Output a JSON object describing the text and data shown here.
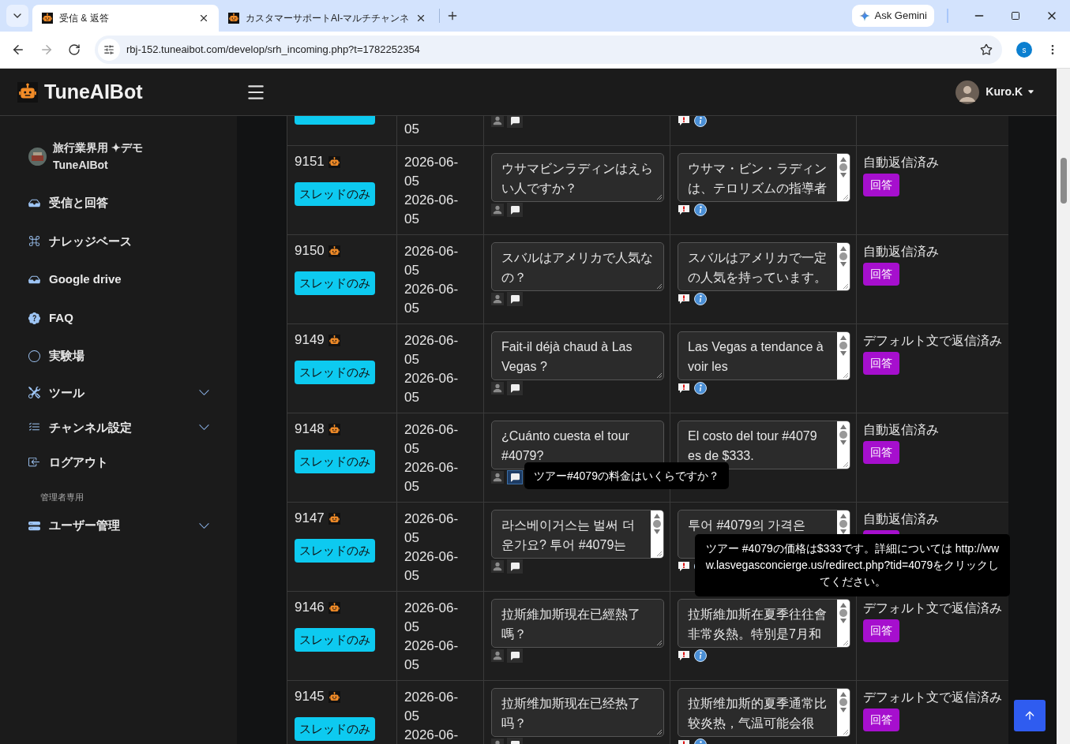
{
  "browser": {
    "tabs": [
      {
        "title": "受信 & 返答",
        "selected": true
      },
      {
        "title": "カスタマーサポートAI-マルチチャンネ",
        "selected": false
      }
    ],
    "ask_gemini": "Ask Gemini",
    "url": "rbj-152.tuneaibot.com/develop/srh_incoming.php?t=1782252354",
    "profile": "s"
  },
  "app": {
    "brand": "TuneAIBot",
    "user": "Kuro.K"
  },
  "sidebar": {
    "account": [
      "旅行業界用 ✦デモ",
      "TuneAIBot"
    ],
    "items": [
      {
        "label": "受信と回答",
        "submenu": false
      },
      {
        "label": "ナレッジベース",
        "submenu": false
      },
      {
        "label": "Google drive",
        "submenu": false
      },
      {
        "label": "FAQ",
        "submenu": false
      },
      {
        "label": "実験場",
        "submenu": false
      },
      {
        "label": "ツール",
        "submenu": true
      },
      {
        "label": "チャンネル設定",
        "submenu": true
      },
      {
        "label": "ログアウト",
        "submenu": false
      }
    ],
    "section_label": "管理者専用",
    "admin_items": [
      {
        "label": "ユーザー管理",
        "submenu": true
      }
    ]
  },
  "table": {
    "rows": [
      {
        "kind": "partial",
        "dates": [
          "05"
        ]
      },
      {
        "kind": "full",
        "id": "9151",
        "thread_button": "スレッドのみ",
        "dates": [
          "2026-06-05",
          "2026-06-05"
        ],
        "question": "ウサマビンラディンはえらい人ですか？",
        "question_scrollbar": false,
        "answer": "ウサマ・ビン・ラディンは、テロリズムの指導者",
        "status": "自動返信済み",
        "reply": "回答"
      },
      {
        "kind": "full",
        "id": "9150",
        "thread_button": "スレッドのみ",
        "dates": [
          "2026-06-05",
          "2026-06-05"
        ],
        "question": "スバルはアメリカで人気なの？",
        "question_scrollbar": false,
        "answer": "スバルはアメリカで一定の人気を持っています。",
        "status": "自動返信済み",
        "reply": "回答"
      },
      {
        "kind": "full",
        "id": "9149",
        "thread_button": "スレッドのみ",
        "dates": [
          "2026-06-05",
          "2026-06-05"
        ],
        "question": "Fait-il déjà chaud à Las Vegas ?",
        "question_scrollbar": false,
        "answer": "Las Vegas a tendance à voir les",
        "status": "デフォルト文で返信済み",
        "reply": "回答"
      },
      {
        "kind": "full",
        "id": "9148",
        "thread_button": "スレッドのみ",
        "dates": [
          "2026-06-05",
          "2026-06-05"
        ],
        "question": "¿Cuánto cuesta el tour #4079?",
        "question_scrollbar": false,
        "answer": "El costo del tour #4079 es de $333.",
        "status": "自動返信済み",
        "reply": "回答",
        "question_tooltip": "ツアー#4079の料金はいくらですか？"
      },
      {
        "kind": "full",
        "id": "9147",
        "thread_button": "スレッドのみ",
        "dates": [
          "2026-06-05",
          "2026-06-05"
        ],
        "question": "라스베이거스는 벌써 더운가요? 투어 #4079는",
        "question_scrollbar": true,
        "answer": "투어 #4079의 가격은",
        "status": "自動返信済み",
        "answer_tooltip": "ツアー #4079の価格は$333です。詳細については http://www.lasvegasconcierge.us/redirect.php?tid=4079をクリックしてください。"
      },
      {
        "kind": "full",
        "id": "9146",
        "thread_button": "スレッドのみ",
        "dates": [
          "2026-06-05",
          "2026-06-05"
        ],
        "question": "拉斯維加斯現在已經熱了嗎？",
        "question_scrollbar": false,
        "answer": "拉斯維加斯在夏季往往會非常炎熱。特別是7月和",
        "status": "デフォルト文で返信済み",
        "reply": "回答"
      },
      {
        "kind": "full",
        "id": "9145",
        "thread_button": "スレッドのみ",
        "dates": [
          "2026-06-05",
          "2026-06-"
        ],
        "question": "拉斯维加斯现在已经热了吗？",
        "question_scrollbar": false,
        "answer": "拉斯维加斯的夏季通常比较炎热，气温可能会很",
        "status": "デフォルト文で返信済み",
        "reply": "回答"
      }
    ]
  }
}
